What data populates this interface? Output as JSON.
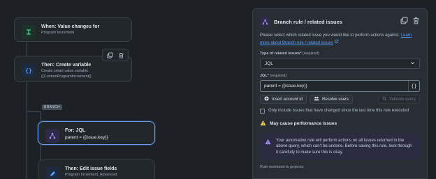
{
  "canvas": {
    "trigger": {
      "title": "When: Value changes for",
      "subtitle": "Program Increment"
    },
    "create_variable": {
      "title": "Then: Create variable",
      "subtitle_line1": "Create smart value variable",
      "subtitle_line2": "{{CustomProgramIncrement}}"
    },
    "branch_tag": "BRANCH",
    "for_node": {
      "title": "For: JQL",
      "subtitle": "parent = {{issue.key}}"
    },
    "edit_node": {
      "title": "Then: Edit issue fields",
      "subtitle": "Program Increment, Advanced"
    }
  },
  "panel": {
    "title": "Branch rule / related issues",
    "description": "Please select which related issue you would like to perform actions against.",
    "learn_more_link": "Learn more about Branch rule / related issues",
    "type_label": "Type of related issues*",
    "type_required": "(required)",
    "type_value": "JQL",
    "jql_label": "JQL*",
    "jql_required": "(required)",
    "jql_value": "parent = {{issue.key}}",
    "braces": "{}",
    "insert_account_button": "Insert account id",
    "resolve_users_button": "Resolve users",
    "validate_query_button": "Validate query",
    "checkbox_label": "Only include issues that have changed since the last time this rule executed",
    "warning_text": "May cause performance issues",
    "info_text": "Your automation rule will perform actions on all issues returned in the above query, which can't be undone. Before saving this rule, look through it carefully to make sure this is okay.",
    "restricted_label": "Rule restricted to projects"
  },
  "colors": {
    "accent_blue": "#579dff",
    "selected_border": "#669df1",
    "warning": "#f5cd47",
    "info_purple": "#9f8fef"
  }
}
